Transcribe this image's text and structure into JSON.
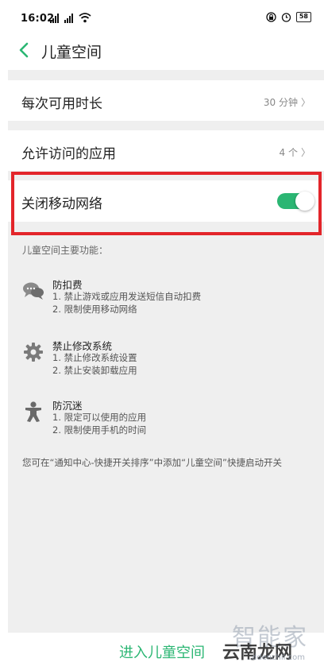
{
  "status": {
    "time": "16:02",
    "battery": "58"
  },
  "header": {
    "title": "儿童空间"
  },
  "settings": [
    {
      "label": "每次可用时长",
      "value": "30 分钟"
    },
    {
      "label": "允许访问的应用",
      "value": "4 个"
    }
  ],
  "network_toggle": {
    "label": "关闭移动网络",
    "on": true
  },
  "section_title": "儿童空间主要功能：",
  "features": [
    {
      "icon": "chat-bubbles-icon",
      "title": "防扣费",
      "lines": [
        "1. 禁止游戏或应用发送短信自动扣费",
        "2. 限制使用移动网络"
      ]
    },
    {
      "icon": "gear-icon",
      "title": "禁止修改系统",
      "lines": [
        "1. 禁止修改系统设置",
        "2. 禁止安装卸载应用"
      ]
    },
    {
      "icon": "child-figure-icon",
      "title": "防沉迷",
      "lines": [
        "1. 限定可以使用的应用",
        "2. 限制使用手机的时间"
      ]
    }
  ],
  "tip": "您可在“通知中心-快捷开关排序”中添加“儿童空间”快捷启动开关",
  "enter_button": "进入儿童空间",
  "watermark": {
    "big": "智能家",
    "mid": "云南龙网",
    "url": "..ddenchil.com"
  },
  "colors": {
    "accent": "#2bb673",
    "highlight": "#e3252a",
    "panel_bg": "#efefef"
  }
}
